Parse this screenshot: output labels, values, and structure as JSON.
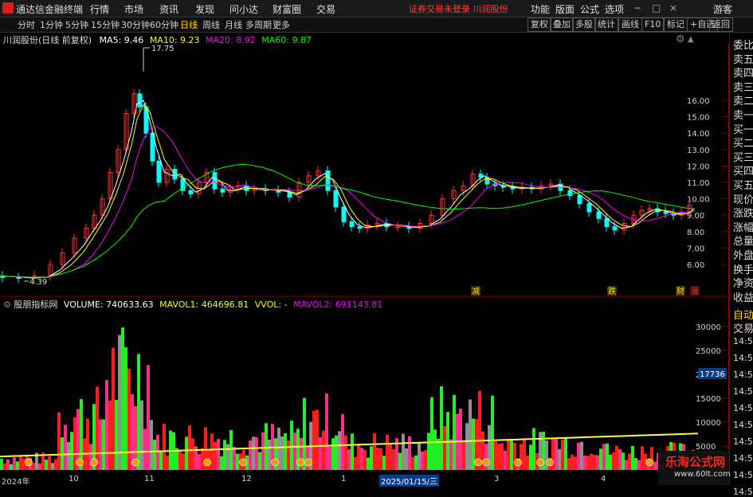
{
  "menubar": {
    "app_title": "通达信金融终端",
    "menus": [
      "行情",
      "市场",
      "资讯",
      "发现",
      "问小达",
      "财富圈",
      "交易"
    ],
    "status_text": "证券交易未登录  川润股份",
    "right_menus": [
      "功能",
      "版面",
      "公式",
      "选项"
    ],
    "guest": "游客"
  },
  "toolbar": {
    "periods": [
      "分时",
      "1分钟",
      "5分钟",
      "15分钟",
      "30分钟",
      "60分钟",
      "日线",
      "周线",
      "月线",
      "多周期",
      "更多"
    ],
    "active_period": "日线",
    "right_buttons": [
      "复权",
      "叠加",
      "多股",
      "统计",
      "画线",
      "F10",
      "标记",
      "+自选",
      "返回"
    ]
  },
  "price_panel": {
    "stock_title": "川润股份(日线 前复权)",
    "ma": [
      {
        "label": "MA5: 9.46",
        "color": "#ffffff"
      },
      {
        "label": "MA10: 9.23",
        "color": "#ffff00"
      },
      {
        "label": "MA20: 8.92",
        "color": "#ff00ff"
      },
      {
        "label": "MA60: 9.87",
        "color": "#00ff00"
      }
    ],
    "high_label": "17.75",
    "low_label": "4.39",
    "y_ticks": [
      "16.00",
      "15.00",
      "14.00",
      "13.00",
      "12.00",
      "11.00",
      "10.00",
      "9.00",
      "8.00",
      "7.00",
      "6.00"
    ],
    "markers": [
      {
        "text": "减",
        "color": "#ffde00"
      },
      {
        "text": "跌",
        "color": "#ffde00"
      },
      {
        "text": "财",
        "color": "#ffde00"
      },
      {
        "text": "涨",
        "color": "#ff3030"
      }
    ]
  },
  "volume_panel": {
    "title": "股朋指标网",
    "volume": "VOLUME: 740633.63",
    "mavol1": "MAVOL1: 464696.81",
    "vvol": "VVOL: -",
    "mavol2": "MAVOL2: 691143.81",
    "y_ticks": [
      "30000",
      "25000",
      "20000",
      "15000",
      "10000",
      "5000"
    ],
    "cursor_value": "17736"
  },
  "date_axis": [
    "2024年",
    "10",
    "11",
    "12",
    "1",
    "2025/01/15/三",
    "3",
    "4"
  ],
  "side_panel": {
    "labels": [
      "委比",
      "卖五",
      "卖四",
      "卖三",
      "卖二",
      "卖一",
      "买一",
      "买二",
      "买三",
      "买四",
      "买五",
      "现价",
      "涨跌",
      "涨幅",
      "总量",
      "外盘",
      "换手",
      "净资",
      "收益"
    ],
    "auto_label": "自动",
    "trade_label": "交易",
    "times": [
      "14:56",
      "14:56",
      "14:56",
      "14:56",
      "14:56",
      "14:56",
      "14:56",
      "14:56",
      "14:56",
      "14:56"
    ]
  },
  "watermark": {
    "title": "乐淘公式网",
    "url": "www.60lt.com"
  }
}
